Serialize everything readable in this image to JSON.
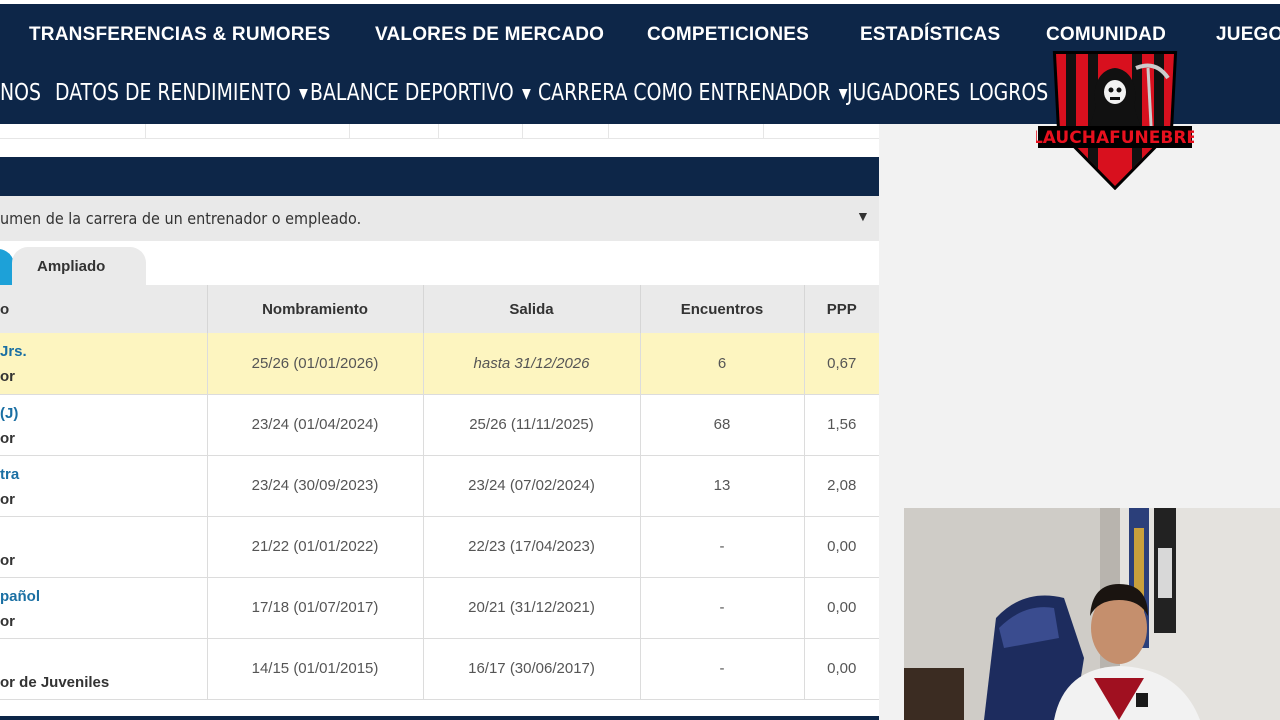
{
  "top_nav": {
    "items": [
      "TRANSFERENCIAS & RUMORES",
      "VALORES DE MERCADO",
      "COMPETICIONES",
      "ESTADÍSTICAS",
      "COMUNIDAD",
      "JUEGO"
    ]
  },
  "sub_nav": {
    "items": [
      "NOS",
      "DATOS DE RENDIMIENTO",
      "BALANCE DEPORTIVO",
      "CARRERA COMO ENTRENADOR",
      "JUGADORES",
      "LOGROS"
    ],
    "caret": "▼"
  },
  "description": {
    "text": "umen de la carrera de un entrenador o empleado.",
    "caret": "▼"
  },
  "tabs": {
    "second_label": "Ampliado"
  },
  "table": {
    "headers": [
      "o",
      "Nombramiento",
      "Salida",
      "Encuentros",
      "PPP"
    ],
    "rows": [
      {
        "club": "Jrs.",
        "role": "or",
        "appointed": "25/26 (01/01/2026)",
        "left": "hasta 31/12/2026",
        "matches": "6",
        "ppp": "0,67"
      },
      {
        "club": "(J)",
        "role": "or",
        "appointed": "23/24 (01/04/2024)",
        "left": "25/26 (11/11/2025)",
        "matches": "68",
        "ppp": "1,56"
      },
      {
        "club": "tra",
        "role": "or",
        "appointed": "23/24 (30/09/2023)",
        "left": "23/24 (07/02/2024)",
        "matches": "13",
        "ppp": "2,08"
      },
      {
        "club": "",
        "role": "or",
        "appointed": "21/22 (01/01/2022)",
        "left": "22/23 (17/04/2023)",
        "matches": "-",
        "ppp": "0,00"
      },
      {
        "club": "pañol",
        "role": "or",
        "appointed": "17/18 (01/07/2017)",
        "left": "20/21 (31/12/2021)",
        "matches": "-",
        "ppp": "0,00"
      },
      {
        "club": "",
        "role": "or de Juveniles",
        "appointed": "14/15 (01/01/2015)",
        "left": "16/17 (30/06/2017)",
        "matches": "-",
        "ppp": "0,00"
      }
    ]
  },
  "logo": {
    "text": "LAUCHAFUNEBRE"
  },
  "colors": {
    "navy": "#0d2648",
    "accent_blue": "#1da1d8",
    "highlight_row": "#fdf5c0",
    "link": "#1a6fa3",
    "logo_red": "#d8101e"
  }
}
